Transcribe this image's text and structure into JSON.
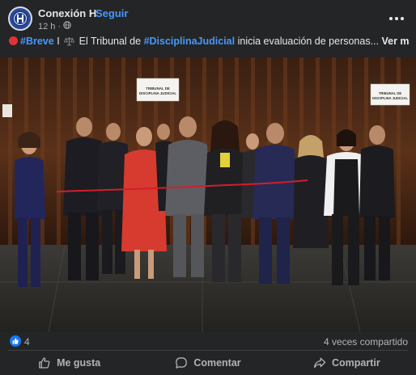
{
  "header": {
    "page_name": "Conexión H",
    "separator": "·",
    "follow_label": "Seguir",
    "time_ago": "12 h",
    "meta_separator": "·"
  },
  "caption": {
    "hashtag_1": "#Breve",
    "bar": "I",
    "text_before": "El Tribunal de",
    "hashtag_2": "#DisciplinaJudicial",
    "text_after": "inicia evaluación de personas...",
    "see_more": "Ver más"
  },
  "photo": {
    "sign_left_line1": "TRIBUNAL DE",
    "sign_left_line2": "DISCIPLINA JUDICIAL",
    "sign_right_line1": "TRIBUNAL DE",
    "sign_right_line2": "DISCIPLINA JUDICIAL"
  },
  "stats": {
    "reactions_count": "4",
    "shares": "4 veces compartido"
  },
  "actions": {
    "like": "Me gusta",
    "comment": "Comentar",
    "share": "Compartir"
  },
  "icons": {
    "avatar": "institution-logo",
    "globe": "globe-icon",
    "more": "more-dots-icon",
    "like": "thumbs-up-icon",
    "comment": "comment-bubble-icon",
    "share": "share-arrow-icon"
  },
  "colors": {
    "background": "#242526",
    "text": "#e4e6eb",
    "muted": "#b0b3b8",
    "link": "#4599ff",
    "like_blue": "#1877f2",
    "live_red": "#e0323a"
  }
}
